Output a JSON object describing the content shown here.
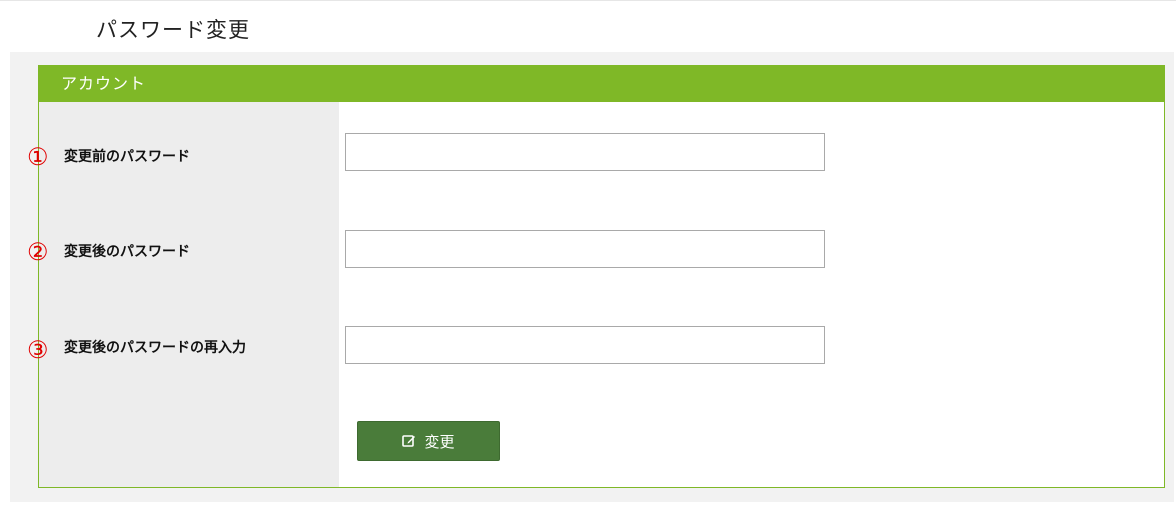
{
  "page": {
    "title": "パスワード変更"
  },
  "panel": {
    "header": "アカウント",
    "header_color": "#7fb827"
  },
  "form": {
    "fields": [
      {
        "marker": "①",
        "label": "変更前のパスワード",
        "value": ""
      },
      {
        "marker": "②",
        "label": "変更後のパスワード",
        "value": ""
      },
      {
        "marker": "③",
        "label": "変更後のパスワードの再入力",
        "value": ""
      }
    ],
    "submit": {
      "label": "変更",
      "icon": "edit-icon",
      "color": "#4a7c3a"
    }
  },
  "colors": {
    "marker": "#e00000"
  }
}
